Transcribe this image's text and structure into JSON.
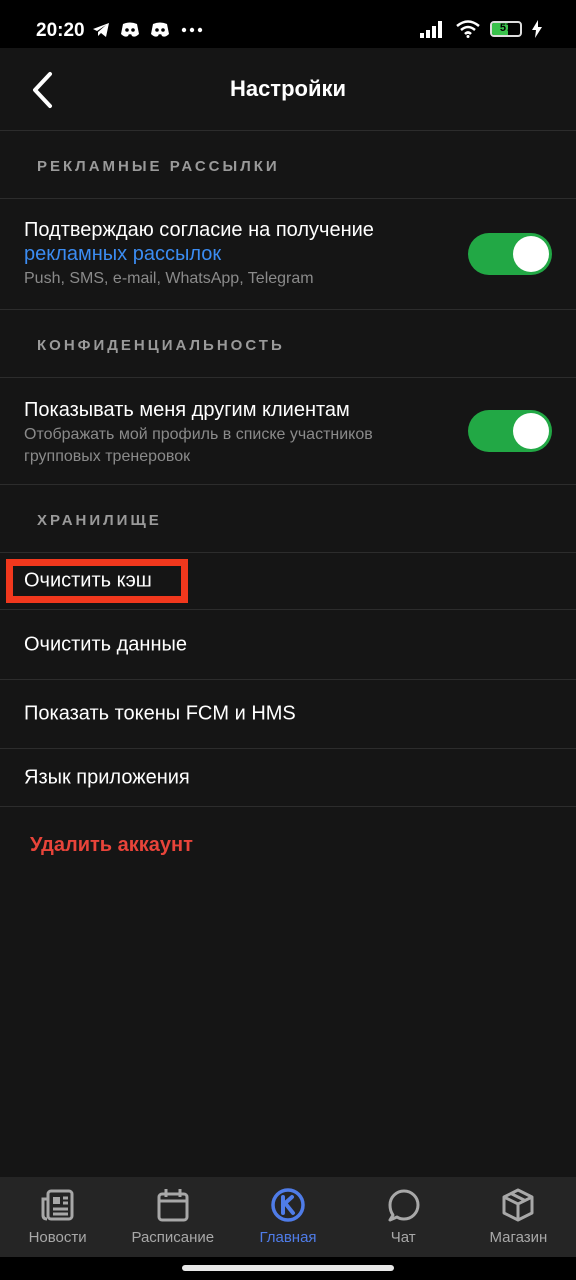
{
  "status_bar": {
    "time": "20:20",
    "left_icons": [
      "telegram-icon",
      "discord-icon",
      "discord-icon",
      "more-dots-icon"
    ],
    "right_icons": [
      "signal-icon",
      "wifi-icon",
      "battery-icon",
      "charging-icon"
    ],
    "battery_level": "57",
    "battery_fraction": 0.57,
    "battery_color": "#3ac24c"
  },
  "header": {
    "title": "Настройки",
    "back_icon": "chevron-left-icon"
  },
  "sections": {
    "ads": {
      "title": "РЕКЛАМНЫЕ РАССЫЛКИ",
      "row": {
        "title": "Подтверждаю согласие на получение",
        "link": "рекламных рассылок",
        "subtitle": "Push, SMS, e-mail, WhatsApp, Telegram",
        "toggle_on": true
      }
    },
    "privacy": {
      "title": "КОНФИДЕНЦИАЛЬНОСТЬ",
      "row": {
        "title": "Показывать меня другим клиентам",
        "subtitle_line1": "Отображать мой профиль в списке участников",
        "subtitle_line2": "групповых тренеровок",
        "toggle_on": true
      }
    },
    "storage": {
      "title": "ХРАНИЛИЩЕ",
      "items": [
        {
          "label": "Очистить кэш"
        },
        {
          "label": "Очистить данные"
        },
        {
          "label": "Показать токены FCM и HMS"
        },
        {
          "label": "Язык приложения"
        }
      ]
    }
  },
  "delete_account": "Удалить аккаунт",
  "colors": {
    "background": "#151515",
    "toggle_on": "#22a845",
    "link": "#3b8cf2",
    "danger": "#e8443a",
    "highlight": "#f1381d",
    "nav_active": "#4f7ce8"
  },
  "bottom_nav": [
    {
      "label": "Новости",
      "icon": "news-icon",
      "active": false
    },
    {
      "label": "Расписание",
      "icon": "calendar-icon",
      "active": false
    },
    {
      "label": "Главная",
      "icon": "home-logo-icon",
      "active": true
    },
    {
      "label": "Чат",
      "icon": "chat-icon",
      "active": false
    },
    {
      "label": "Магазин",
      "icon": "box-icon",
      "active": false
    }
  ]
}
